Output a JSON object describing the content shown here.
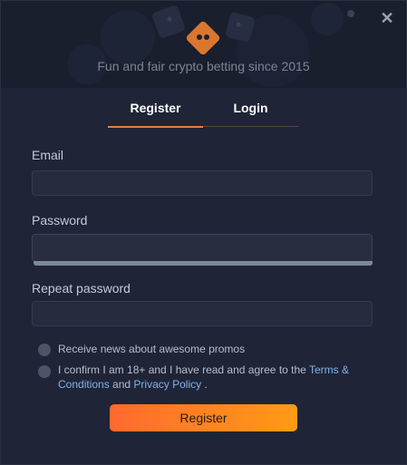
{
  "header": {
    "tagline": "Fun and fair crypto betting since 2015",
    "close_glyph": "✕"
  },
  "tabs": [
    {
      "label": "Register",
      "active": true
    },
    {
      "label": "Login",
      "active": false
    }
  ],
  "form": {
    "email_label": "Email",
    "email_value": "",
    "password_label": "Password",
    "password_value": "",
    "repeat_label": "Repeat password",
    "repeat_value": ""
  },
  "checkboxes": {
    "promos": "Receive news about awesome promos",
    "confirm_prefix": "I confirm I am 18+ and I have read and agree to the",
    "terms_link": "Terms &",
    "terms_link_2": "Conditions",
    "and_text": "and",
    "privacy_link": "Privacy Policy",
    "suffix": "."
  },
  "submit_label": "Register",
  "colors": {
    "accent": "#ef7a3e",
    "button_start": "#ff6a2e",
    "button_end": "#ff9b14",
    "link": "#7fb2ee"
  }
}
